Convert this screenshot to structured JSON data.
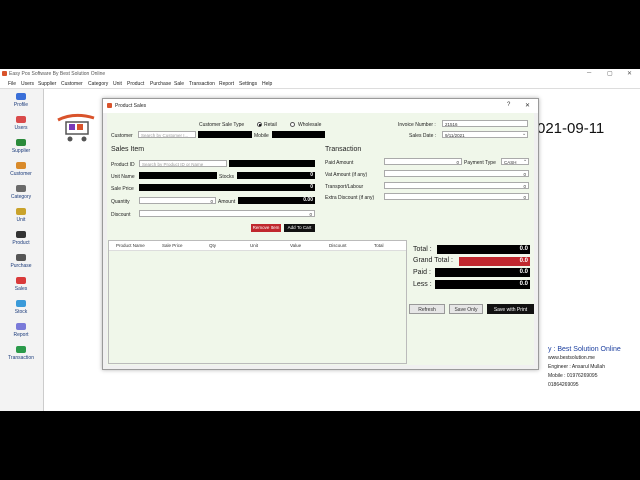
{
  "window": {
    "title": "Easy Pos Software By Best Solution Online"
  },
  "menu": [
    "File",
    "Users",
    "Supplier",
    "Customer",
    "Category",
    "Unit",
    "Product",
    "Purchase",
    "Sale",
    "Transaction",
    "Report",
    "Settings",
    "Help"
  ],
  "sidebar": [
    {
      "label": "Profile",
      "color": "#3a6fd8"
    },
    {
      "label": "Users",
      "color": "#d94a4a"
    },
    {
      "label": "Supplier",
      "color": "#2a8a3a"
    },
    {
      "label": "Customer",
      "color": "#d98a2a"
    },
    {
      "label": "Category",
      "color": "#6a6a6a"
    },
    {
      "label": "Unit",
      "color": "#c9a22a"
    },
    {
      "label": "Product",
      "color": "#333333"
    },
    {
      "label": "Purchase",
      "color": "#555555"
    },
    {
      "label": "Sales",
      "color": "#d93a3a"
    },
    {
      "label": "Stock",
      "color": "#3a9ad9"
    },
    {
      "label": "Report",
      "color": "#7a7ad9"
    },
    {
      "label": "Transaction",
      "color": "#2a9a4a"
    }
  ],
  "background": {
    "date": "021-09-11",
    "brand": "y : Best Solution Online",
    "website": "www.bestsolution.me",
    "engineer": "Engineer : Ansarul Mullah",
    "mobile": "Mobile : 01976269095",
    "mobile2": "01864269095"
  },
  "dialog": {
    "title": "Product Sales",
    "help": "?",
    "close": "✕",
    "customer_sale_type_label": "Customer Sale Type",
    "retail": "Retail",
    "wholesale": "Wholesale",
    "customer_label": "Customer",
    "customer_placeholder": "Search by Customer I...",
    "mobile_label": "Mobile",
    "invoice_label": "Invoice Number :",
    "invoice_value": "21516",
    "sales_date_label": "Sales Date :",
    "sales_date_value": "9/11/2021",
    "sales_item": "Sales Item",
    "product_id_label": "Product ID",
    "product_placeholder": "Search by Product ID or Name",
    "unit_name_label": "Unit Name",
    "stocks_label": "Stocks",
    "stocks_value": "0",
    "sale_price_label": "Sale Price",
    "sale_price_value": "0",
    "quantity_label": "Quantity",
    "quantity_value": "0",
    "amount_label": "Amount",
    "amount_value": "0.00",
    "discount_label": "Discount",
    "discount_value": "0",
    "remove_btn": "Remove Item",
    "add_btn": "Add To Cart",
    "transaction": "Transaction",
    "paid_amount_label": "Paid Amount",
    "paid_amount_value": "0",
    "payment_type_label": "Payment Type",
    "payment_type_value": "CASH",
    "vat_label": "Vat Amount (if any)",
    "vat_value": "0",
    "transport_label": "Transport/Labour",
    "transport_value": "0",
    "extra_discount_label": "Extra Discount (if any)",
    "extra_discount_value": "0",
    "columns": [
      "Product Name",
      "Sale Price",
      "Qty",
      "Unit",
      "Value",
      "Discount",
      "Total"
    ],
    "total_label": "Total :",
    "total_value": "0.0",
    "grand_total_label": "Grand Total :",
    "grand_total_value": "0.0",
    "paid_label": "Paid :",
    "paid_value": "0.0",
    "less_label": "Less :",
    "less_value": "0.0",
    "refresh_btn": "Refresh",
    "save_only_btn": "Save Only",
    "save_print_btn": "Save with Print"
  }
}
